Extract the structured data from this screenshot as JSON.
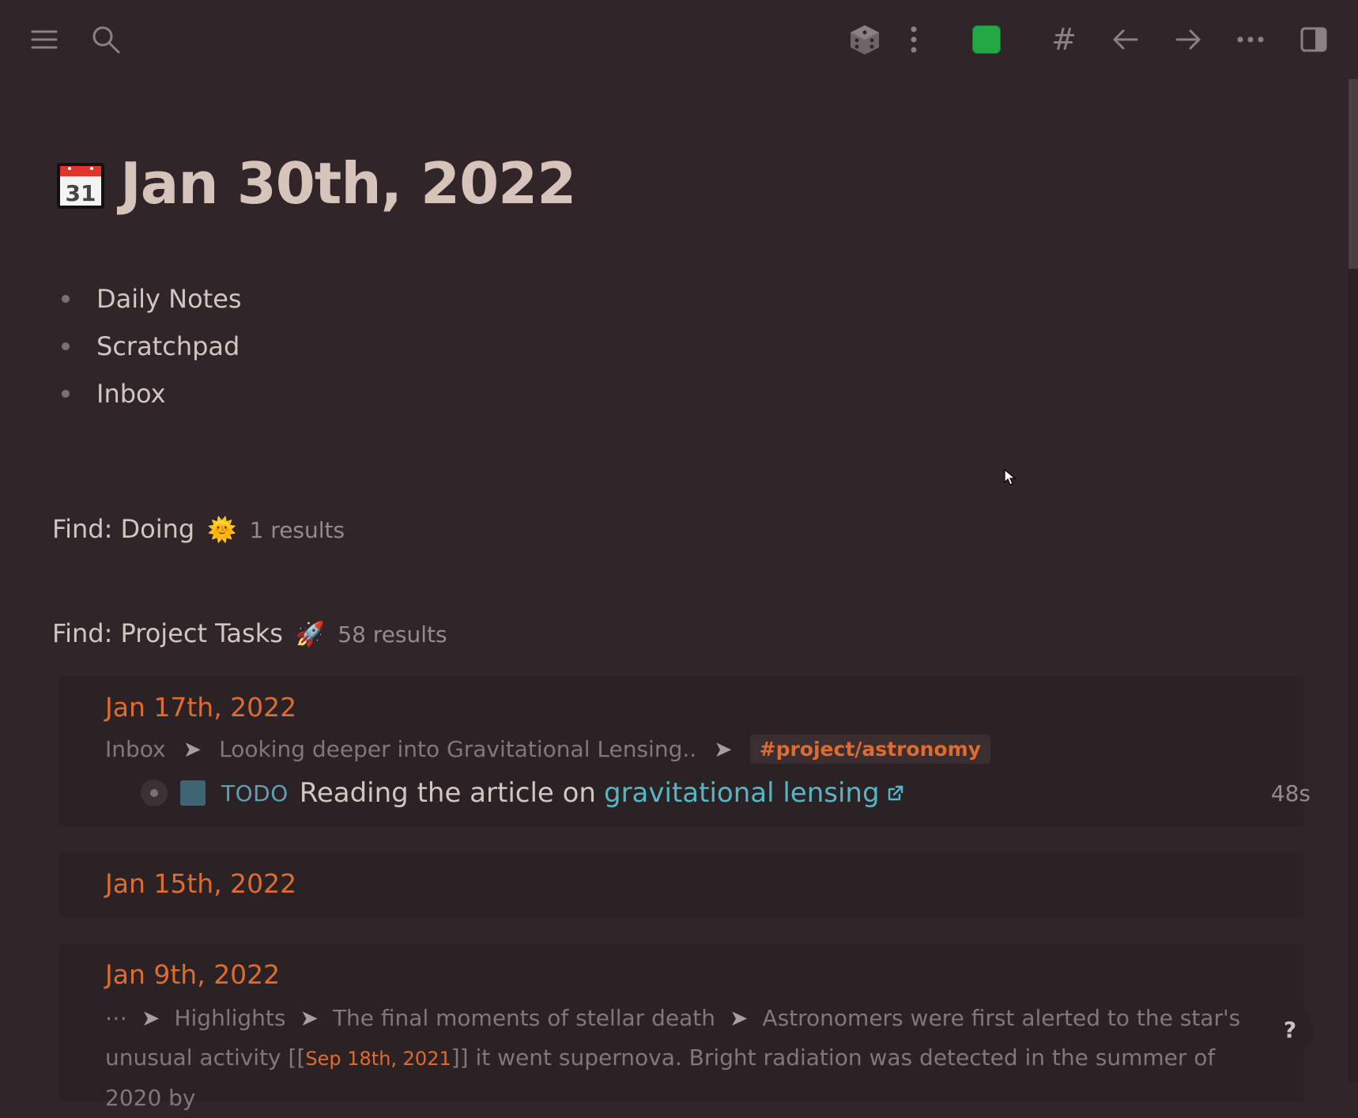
{
  "toolbar": {
    "menu_icon": "hamburger-icon",
    "search_icon": "search-icon",
    "dice_icon": "dice-icon",
    "kebab_icon": "vertical-dots-icon",
    "color_swatch": "#23a846",
    "hash_label": "#",
    "back_icon": "arrow-left-icon",
    "forward_icon": "arrow-right-icon",
    "more_icon": "horizontal-dots-icon",
    "sidebar_icon": "right-sidebar-icon"
  },
  "page": {
    "title_icon": "calendar-icon",
    "calendar_day": "31",
    "title": "Jan 30th, 2022"
  },
  "blocks": [
    "Daily Notes",
    "Scratchpad",
    "Inbox"
  ],
  "queries": [
    {
      "title": "Find: Doing",
      "emoji": "🌞",
      "count": "1 results"
    },
    {
      "title": "Find: Project Tasks",
      "emoji": "🚀",
      "count": "58 results"
    }
  ],
  "results": {
    "card1": {
      "date": "Jan 17th, 2022",
      "crumbs": [
        "Inbox",
        "Looking deeper into Gravitational Lensing.."
      ],
      "tag": "#project/astronomy",
      "task_marker": "TODO",
      "task_text": "Reading the article on",
      "task_link": "gravitational lensing",
      "task_time": "48s"
    },
    "card2": {
      "date": "Jan 15th, 2022"
    },
    "card3": {
      "date": "Jan 9th, 2022",
      "crumb_ellipsis": "⋯",
      "crumb1": "Highlights",
      "crumb2": "The final moments of stellar death",
      "crumb3": "Astronomers were first alerted to the star's",
      "line2_a": "unusual activity [[",
      "line2_ref": "Sep 18th, 2021",
      "line2_b": "]] it went supernova. Bright radiation was detected in the summer of 2020 by"
    }
  },
  "help_label": "?"
}
